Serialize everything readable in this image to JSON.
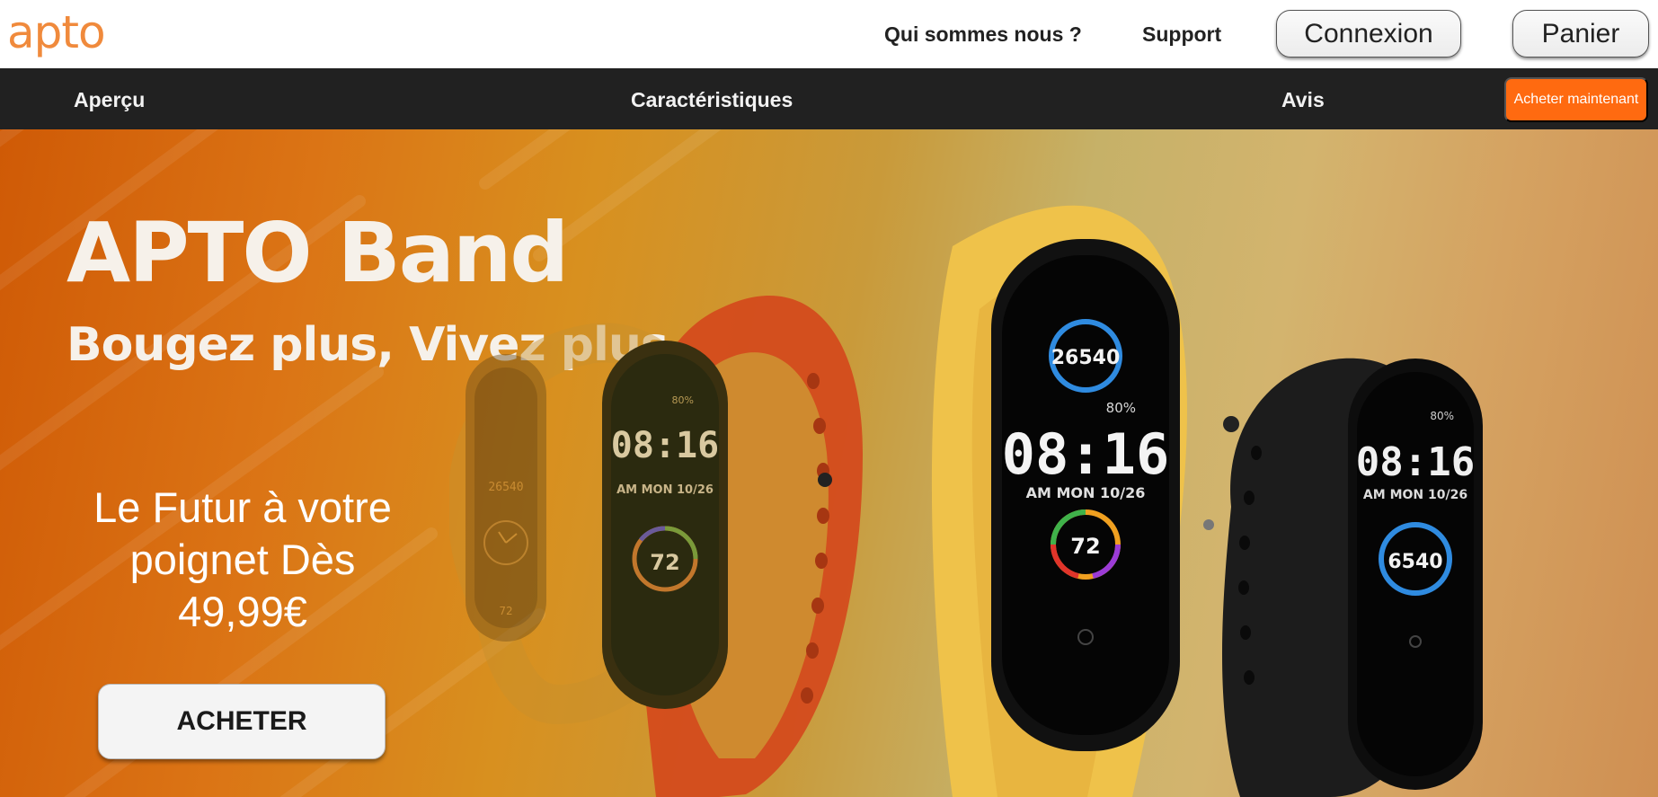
{
  "header": {
    "logo": "apto",
    "links": [
      "Qui sommes nous ?",
      "Support"
    ],
    "login_label": "Connexion",
    "cart_label": "Panier"
  },
  "nav": {
    "items": [
      "Aperçu",
      "Caractéristiques",
      "Avis"
    ],
    "buy_now_label": "Acheter maintenant",
    "accent": "#ff6a10"
  },
  "hero": {
    "title": "APTO Band",
    "subtitle": "Bougez plus, Vivez plus",
    "tagline": "Le Futur à votre poignet Dès 49,99€",
    "cta_label": "ACHETER",
    "band_colors": [
      "#d8a437",
      "#e2521f",
      "#f0c040",
      "#1c1c1c"
    ],
    "bands": [
      {
        "steps": "26540",
        "time": "",
        "date": "",
        "heart": "72",
        "battery": ""
      },
      {
        "steps": "",
        "time": "08:16",
        "date": "AM MON 10/26",
        "heart": "72",
        "battery": "80%"
      },
      {
        "steps": "26540",
        "time": "08:16",
        "date": "AM MON 10/26",
        "heart": "72",
        "battery": "80%"
      },
      {
        "steps": "6540",
        "time": "08:16",
        "date": "AM MON 10/26",
        "heart": "",
        "battery": "80%"
      }
    ]
  }
}
